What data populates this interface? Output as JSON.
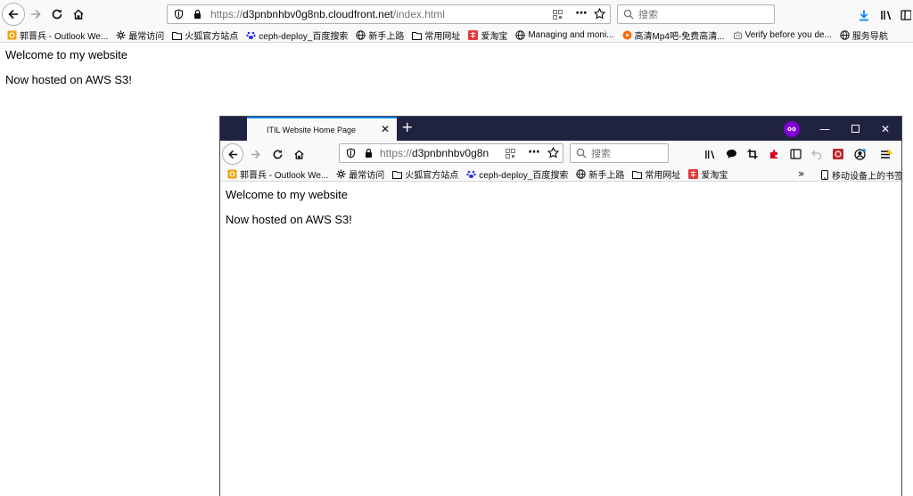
{
  "outer": {
    "url_prefix": "https://",
    "url_host": "d3pnbnhbv0g8nb.cloudfront.net",
    "url_path": "/index.html",
    "search_placeholder": "搜索",
    "bookmarks": [
      {
        "label": "郭晋兵 - Outlook We...",
        "icon": "outlook-icon"
      },
      {
        "label": "最常访问",
        "icon": "gear-icon"
      },
      {
        "label": "火狐官方站点",
        "icon": "folder-icon"
      },
      {
        "label": "ceph-deploy_百度搜索",
        "icon": "baidu-paw-icon"
      },
      {
        "label": "新手上路",
        "icon": "globe-icon"
      },
      {
        "label": "常用网址",
        "icon": "folder-icon"
      },
      {
        "label": "爱淘宝",
        "icon": "taobao-icon"
      },
      {
        "label": "Managing and moni...",
        "icon": "globe-icon"
      },
      {
        "label": "高清Mp4吧-免费高清...",
        "icon": "play-icon"
      },
      {
        "label": "Verify before you de...",
        "icon": "robot-icon"
      },
      {
        "label": "服务导航",
        "icon": "globe-icon"
      }
    ],
    "content": {
      "line1": "Welcome to my website",
      "line2": "Now hosted on AWS S3!"
    }
  },
  "inner": {
    "tab_title": "ITIL Website Home Page",
    "url_prefix": "https://",
    "url_host": "d3pnbnhbv0g8n",
    "search_placeholder": "搜索",
    "bookmarks": [
      {
        "label": "郭晋兵 - Outlook We...",
        "icon": "outlook-icon"
      },
      {
        "label": "最常访问",
        "icon": "gear-icon"
      },
      {
        "label": "火狐官方站点",
        "icon": "folder-icon"
      },
      {
        "label": "ceph-deploy_百度搜索",
        "icon": "baidu-paw-icon"
      },
      {
        "label": "新手上路",
        "icon": "globe-icon"
      },
      {
        "label": "常用网址",
        "icon": "folder-icon"
      },
      {
        "label": "爱淘宝",
        "icon": "taobao-icon"
      }
    ],
    "mobile_bookmarks": "移动设备上的书签",
    "content": {
      "line1": "Welcome to my website",
      "line2": "Now hosted on AWS S3!"
    }
  },
  "colors": {
    "titlebar": "#202340",
    "toolbar": "#f9f9fa",
    "accent": "#0a84ff",
    "private": "#8000d7",
    "download": "#0a84ff"
  }
}
